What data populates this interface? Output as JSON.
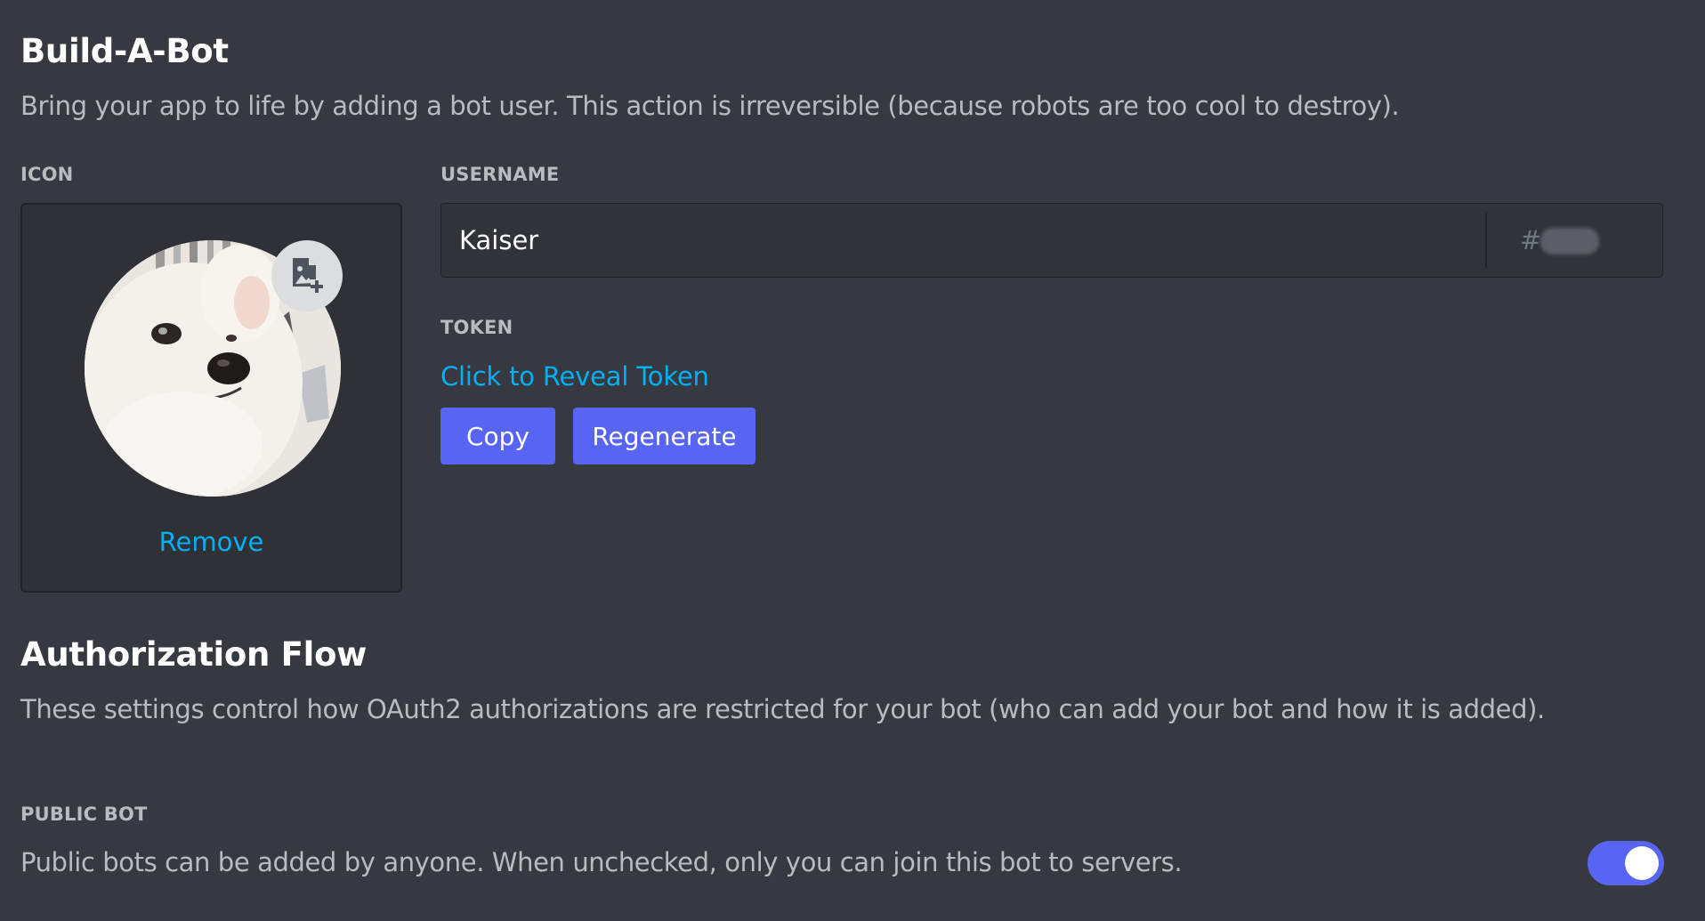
{
  "build_a_bot": {
    "title": "Build-A-Bot",
    "description": "Bring your app to life by adding a bot user. This action is irreversible (because robots are too cool to destroy)."
  },
  "icon_section": {
    "label": "ICON",
    "remove_label": "Remove",
    "upload_icon": "image-add-icon"
  },
  "username_section": {
    "label": "USERNAME",
    "value": "Kaiser",
    "discriminator_prefix": "#"
  },
  "token_section": {
    "label": "TOKEN",
    "reveal_label": "Click to Reveal Token",
    "copy_label": "Copy",
    "regenerate_label": "Regenerate"
  },
  "authorization_flow": {
    "title": "Authorization Flow",
    "description": "These settings control how OAuth2 authorizations are restricted for your bot (who can add your bot and how it is added)."
  },
  "public_bot": {
    "label": "PUBLIC BOT",
    "description": "Public bots can be added by anyone. When unchecked, only you can join this bot to servers.",
    "enabled": true
  },
  "colors": {
    "background": "#36393f",
    "panel": "#2f3136",
    "accent": "#5865f2",
    "link": "#00b0f4"
  }
}
